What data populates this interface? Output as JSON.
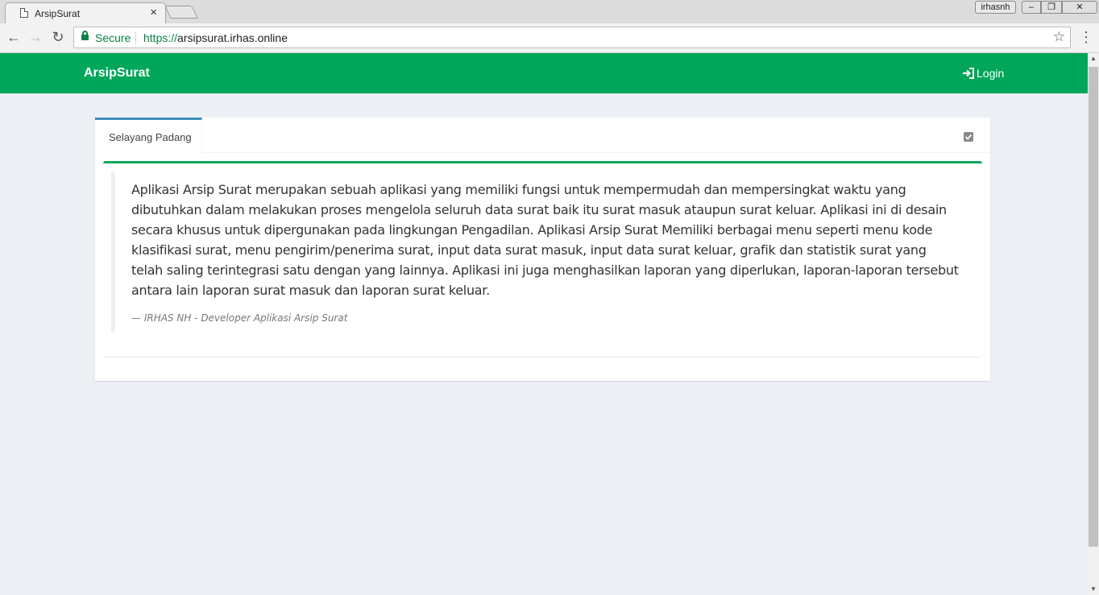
{
  "browser": {
    "tab_title": "ArsipSurat",
    "tab_close": "×",
    "profile_name": "irhasnh",
    "window_min": "–",
    "window_max": "❐",
    "window_close": "✕",
    "secure_label": "Secure",
    "url_scheme": "https://",
    "url_host": "arsipsurat.irhas.online",
    "nav_back": "←",
    "nav_forward": "→",
    "nav_reload": "↻",
    "bookmark": "☆",
    "menu": "⋮"
  },
  "navbar": {
    "brand": "ArsipSurat",
    "login_label": "Login",
    "background_color": "#00a65a"
  },
  "tabs_box": {
    "active_tab_label": "Selayang Padang",
    "tab_border_color": "#3c8dbc"
  },
  "quote": {
    "text": "Aplikasi Arsip Surat merupakan sebuah aplikasi yang memiliki fungsi untuk mempermudah dan mempersingkat waktu yang dibutuhkan dalam melakukan proses mengelola seluruh data surat baik itu surat masuk ataupun surat keluar. Aplikasi ini di desain secara khusus untuk dipergunakan pada lingkungan Pengadilan. Aplikasi Arsip Surat Memiliki berbagai menu seperti menu kode klasifikasi surat, menu pengirim/penerima surat, input data surat masuk, input data surat keluar, grafik dan statistik surat yang telah saling terintegrasi satu dengan yang lainnya. Aplikasi ini juga menghasilkan laporan yang diperlukan, laporan-laporan tersebut antara lain laporan surat masuk dan laporan surat keluar.",
    "footer": "— IRHAS NH - Developer Aplikasi Arsip Surat"
  }
}
